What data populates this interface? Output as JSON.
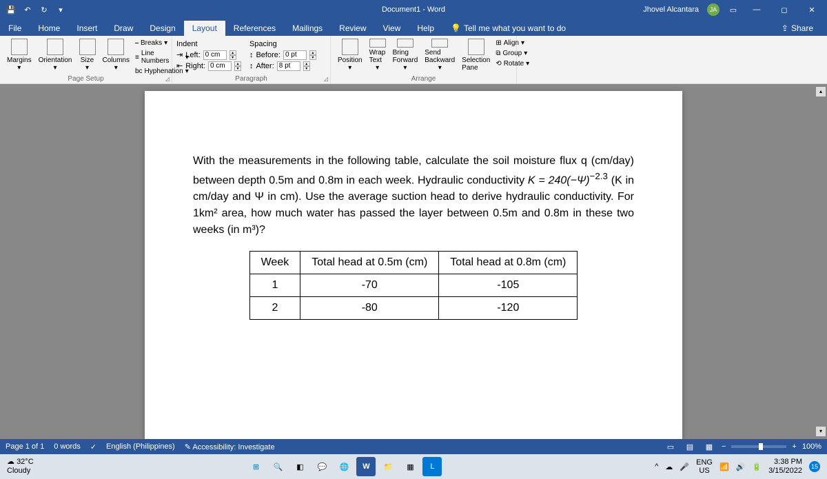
{
  "title_bar": {
    "doc_title": "Document1 - Word",
    "user_name": "Jhovel Alcantara",
    "user_initials": "JA"
  },
  "tabs": {
    "items": [
      "File",
      "Home",
      "Insert",
      "Draw",
      "Design",
      "Layout",
      "References",
      "Mailings",
      "Review",
      "View",
      "Help"
    ],
    "active": "Layout",
    "tell_me": "Tell me what you want to do",
    "share": "Share"
  },
  "ribbon": {
    "page_setup": {
      "label": "Page Setup",
      "margins": "Margins",
      "orientation": "Orientation",
      "size": "Size",
      "columns": "Columns",
      "breaks": "Breaks",
      "line_numbers": "Line Numbers",
      "hyphenation": "Hyphenation"
    },
    "paragraph": {
      "label": "Paragraph",
      "indent": "Indent",
      "spacing": "Spacing",
      "left_label": "Left:",
      "left_val": "0 cm",
      "right_label": "Right:",
      "right_val": "0 cm",
      "before_label": "Before:",
      "before_val": "0 pt",
      "after_label": "After:",
      "after_val": "8 pt"
    },
    "arrange": {
      "label": "Arrange",
      "position": "Position",
      "wrap_text": "Wrap Text",
      "bring_forward": "Bring Forward",
      "send_backward": "Send Backward",
      "selection_pane": "Selection Pane",
      "align": "Align",
      "group": "Group",
      "rotate": "Rotate"
    }
  },
  "document": {
    "para1_a": "With the measurements in the following table, calculate the soil moisture flux q (cm/day) between",
    "para1_b": "depth 0.5m and 0.8m in each week. Hydraulic conductivity ",
    "eq": "K = 240(−Ψ)",
    "eq_exp": "−2.3",
    "para1_c": " (K in cm/day and",
    "para1_d": "Ψ in cm). Use the average suction head to derive hydraulic conductivity. For 1km² area, how much water has passed the layer between 0.5m and 0.8m in these two weeks (in m³)?",
    "table": {
      "h1": "Week",
      "h2": "Total head at 0.5m (cm)",
      "h3": "Total head at 0.8m (cm)",
      "rows": [
        {
          "w": "1",
          "a": "-70",
          "b": "-105"
        },
        {
          "w": "2",
          "a": "-80",
          "b": "-120"
        }
      ]
    }
  },
  "status": {
    "page": "Page 1 of 1",
    "words": "0 words",
    "lang": "English (Philippines)",
    "accessibility": "Accessibility: Investigate",
    "zoom": "100%"
  },
  "taskbar": {
    "temp": "32°C",
    "weather": "Cloudy",
    "lang_code": "ENG",
    "lang_region": "US",
    "time": "3:38 PM",
    "date": "3/15/2022",
    "notif_count": "15"
  }
}
